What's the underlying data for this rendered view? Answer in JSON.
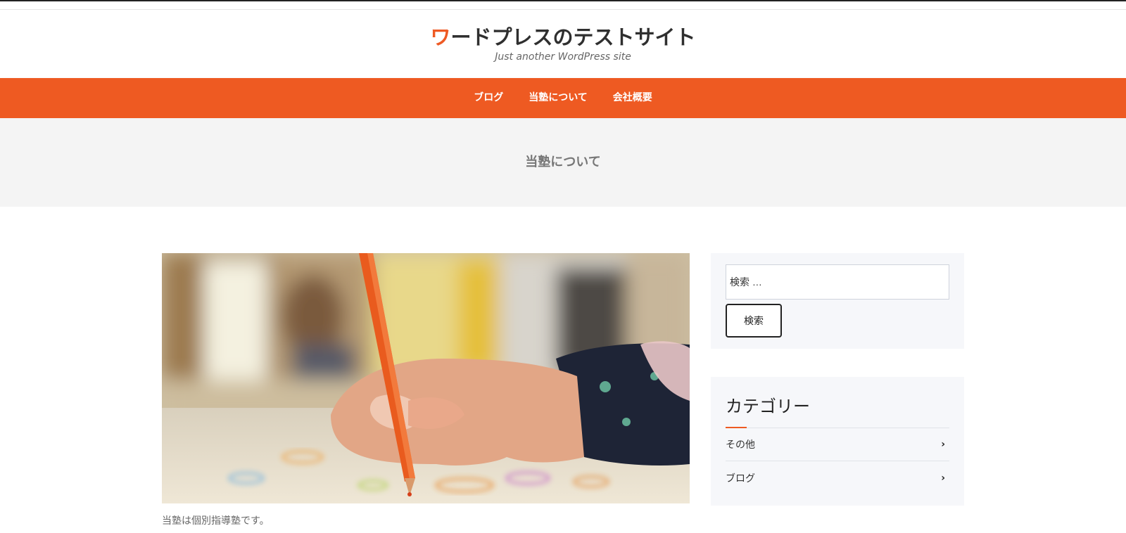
{
  "site": {
    "title_first_char": "ワ",
    "title_rest": "ードプレスのテストサイト",
    "tagline": "Just another WordPress site"
  },
  "nav": {
    "items": [
      {
        "label": "ブログ"
      },
      {
        "label": "当塾について"
      },
      {
        "label": "会社概要"
      }
    ]
  },
  "page": {
    "title": "当塾について",
    "body_text": "当塾は個別指導塾です。"
  },
  "sidebar": {
    "search": {
      "placeholder": "検索 …",
      "button_label": "検索"
    },
    "categories": {
      "title": "カテゴリー",
      "items": [
        {
          "label": "その他"
        },
        {
          "label": "ブログ"
        }
      ]
    }
  },
  "colors": {
    "accent": "#ee5a22",
    "page_header_bg": "#f4f4f4",
    "widget_bg": "#f6f7fa"
  },
  "icons": {
    "chevron": "chevron-right-icon"
  }
}
